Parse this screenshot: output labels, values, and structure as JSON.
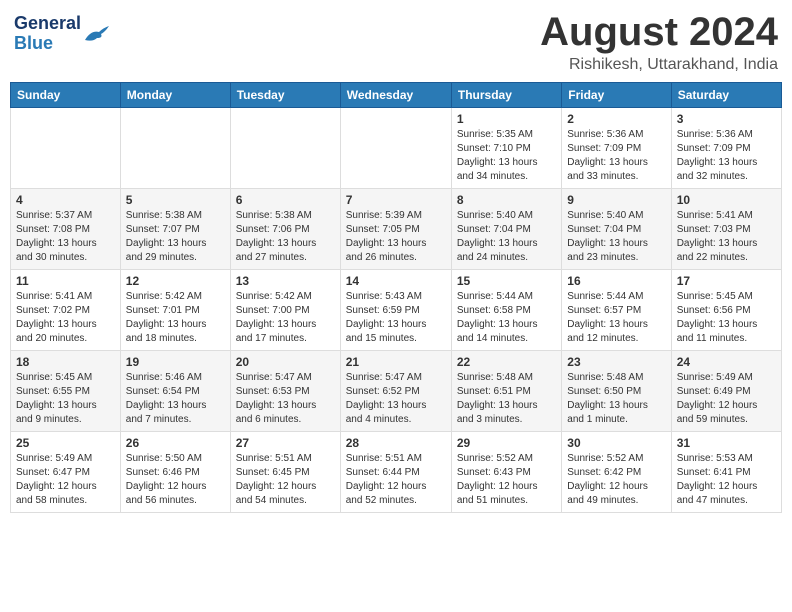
{
  "header": {
    "logo_general": "General",
    "logo_blue": "Blue",
    "month_title": "August 2024",
    "location": "Rishikesh, Uttarakhand, India"
  },
  "days_of_week": [
    "Sunday",
    "Monday",
    "Tuesday",
    "Wednesday",
    "Thursday",
    "Friday",
    "Saturday"
  ],
  "weeks": [
    [
      {
        "day": "",
        "info": ""
      },
      {
        "day": "",
        "info": ""
      },
      {
        "day": "",
        "info": ""
      },
      {
        "day": "",
        "info": ""
      },
      {
        "day": "1",
        "info": "Sunrise: 5:35 AM\nSunset: 7:10 PM\nDaylight: 13 hours\nand 34 minutes."
      },
      {
        "day": "2",
        "info": "Sunrise: 5:36 AM\nSunset: 7:09 PM\nDaylight: 13 hours\nand 33 minutes."
      },
      {
        "day": "3",
        "info": "Sunrise: 5:36 AM\nSunset: 7:09 PM\nDaylight: 13 hours\nand 32 minutes."
      }
    ],
    [
      {
        "day": "4",
        "info": "Sunrise: 5:37 AM\nSunset: 7:08 PM\nDaylight: 13 hours\nand 30 minutes."
      },
      {
        "day": "5",
        "info": "Sunrise: 5:38 AM\nSunset: 7:07 PM\nDaylight: 13 hours\nand 29 minutes."
      },
      {
        "day": "6",
        "info": "Sunrise: 5:38 AM\nSunset: 7:06 PM\nDaylight: 13 hours\nand 27 minutes."
      },
      {
        "day": "7",
        "info": "Sunrise: 5:39 AM\nSunset: 7:05 PM\nDaylight: 13 hours\nand 26 minutes."
      },
      {
        "day": "8",
        "info": "Sunrise: 5:40 AM\nSunset: 7:04 PM\nDaylight: 13 hours\nand 24 minutes."
      },
      {
        "day": "9",
        "info": "Sunrise: 5:40 AM\nSunset: 7:04 PM\nDaylight: 13 hours\nand 23 minutes."
      },
      {
        "day": "10",
        "info": "Sunrise: 5:41 AM\nSunset: 7:03 PM\nDaylight: 13 hours\nand 22 minutes."
      }
    ],
    [
      {
        "day": "11",
        "info": "Sunrise: 5:41 AM\nSunset: 7:02 PM\nDaylight: 13 hours\nand 20 minutes."
      },
      {
        "day": "12",
        "info": "Sunrise: 5:42 AM\nSunset: 7:01 PM\nDaylight: 13 hours\nand 18 minutes."
      },
      {
        "day": "13",
        "info": "Sunrise: 5:42 AM\nSunset: 7:00 PM\nDaylight: 13 hours\nand 17 minutes."
      },
      {
        "day": "14",
        "info": "Sunrise: 5:43 AM\nSunset: 6:59 PM\nDaylight: 13 hours\nand 15 minutes."
      },
      {
        "day": "15",
        "info": "Sunrise: 5:44 AM\nSunset: 6:58 PM\nDaylight: 13 hours\nand 14 minutes."
      },
      {
        "day": "16",
        "info": "Sunrise: 5:44 AM\nSunset: 6:57 PM\nDaylight: 13 hours\nand 12 minutes."
      },
      {
        "day": "17",
        "info": "Sunrise: 5:45 AM\nSunset: 6:56 PM\nDaylight: 13 hours\nand 11 minutes."
      }
    ],
    [
      {
        "day": "18",
        "info": "Sunrise: 5:45 AM\nSunset: 6:55 PM\nDaylight: 13 hours\nand 9 minutes."
      },
      {
        "day": "19",
        "info": "Sunrise: 5:46 AM\nSunset: 6:54 PM\nDaylight: 13 hours\nand 7 minutes."
      },
      {
        "day": "20",
        "info": "Sunrise: 5:47 AM\nSunset: 6:53 PM\nDaylight: 13 hours\nand 6 minutes."
      },
      {
        "day": "21",
        "info": "Sunrise: 5:47 AM\nSunset: 6:52 PM\nDaylight: 13 hours\nand 4 minutes."
      },
      {
        "day": "22",
        "info": "Sunrise: 5:48 AM\nSunset: 6:51 PM\nDaylight: 13 hours\nand 3 minutes."
      },
      {
        "day": "23",
        "info": "Sunrise: 5:48 AM\nSunset: 6:50 PM\nDaylight: 13 hours\nand 1 minute."
      },
      {
        "day": "24",
        "info": "Sunrise: 5:49 AM\nSunset: 6:49 PM\nDaylight: 12 hours\nand 59 minutes."
      }
    ],
    [
      {
        "day": "25",
        "info": "Sunrise: 5:49 AM\nSunset: 6:47 PM\nDaylight: 12 hours\nand 58 minutes."
      },
      {
        "day": "26",
        "info": "Sunrise: 5:50 AM\nSunset: 6:46 PM\nDaylight: 12 hours\nand 56 minutes."
      },
      {
        "day": "27",
        "info": "Sunrise: 5:51 AM\nSunset: 6:45 PM\nDaylight: 12 hours\nand 54 minutes."
      },
      {
        "day": "28",
        "info": "Sunrise: 5:51 AM\nSunset: 6:44 PM\nDaylight: 12 hours\nand 52 minutes."
      },
      {
        "day": "29",
        "info": "Sunrise: 5:52 AM\nSunset: 6:43 PM\nDaylight: 12 hours\nand 51 minutes."
      },
      {
        "day": "30",
        "info": "Sunrise: 5:52 AM\nSunset: 6:42 PM\nDaylight: 12 hours\nand 49 minutes."
      },
      {
        "day": "31",
        "info": "Sunrise: 5:53 AM\nSunset: 6:41 PM\nDaylight: 12 hours\nand 47 minutes."
      }
    ]
  ]
}
